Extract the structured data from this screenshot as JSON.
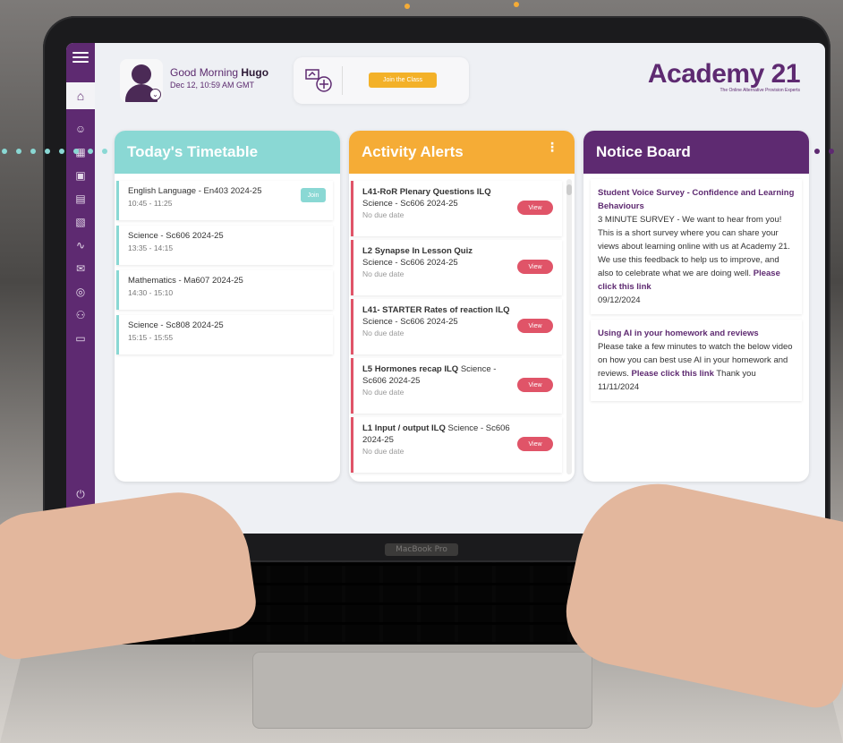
{
  "app": {
    "greeting": "Good Morning",
    "user": "Hugo",
    "datetime": "Dec 12, 10:59 AM GMT",
    "join_button": "Join the Class",
    "brand": "Academy 21",
    "brand_tagline": "The Online Alternative Provision Experts"
  },
  "laptop": {
    "hinge_label": "MacBook Pro"
  },
  "colors": {
    "purple": "#5e2a71",
    "teal": "#8ad8d4",
    "orange": "#f5ac36",
    "red": "#e05468"
  },
  "timetable": {
    "title": "Today's Timetable",
    "items": [
      {
        "subject": "English Language - En403 2024-25",
        "time": "10:45 - 11:25",
        "action": "Join"
      },
      {
        "subject": "Science - Sc606 2024-25",
        "time": "13:35 - 14:15"
      },
      {
        "subject": "Mathematics - Ma607 2024-25",
        "time": "14:30 - 15:10"
      },
      {
        "subject": "Science - Sc808 2024-25",
        "time": "15:15 - 15:55"
      }
    ]
  },
  "alerts": {
    "title": "Activity Alerts",
    "items": [
      {
        "name": "L41-RoR Plenary Questions ILQ",
        "course": "Science - Sc606 2024-25",
        "due": "No due date",
        "action": "View"
      },
      {
        "name": "L2 Synapse In Lesson Quiz",
        "course": "Science - Sc606 2024-25",
        "due": "No due date",
        "action": "View"
      },
      {
        "name": "L41- STARTER Rates of reaction ILQ",
        "course": "Science - Sc606 2024-25",
        "due": "No due date",
        "action": "View"
      },
      {
        "name": "L5 Hormones recap ILQ",
        "course": "Science - Sc606 2024-25",
        "due": "No due date",
        "action": "View"
      },
      {
        "name": "L1 Input / output ILQ",
        "course": "Science - Sc606 2024-25",
        "due": "No due date",
        "action": "View"
      }
    ]
  },
  "notices": {
    "title": "Notice Board",
    "items": [
      {
        "heading": "Student Voice Survey - Confidence and Learning Behaviours",
        "body": "3 MINUTE SURVEY - We want to hear from you! This is a short survey where you can share your views about learning online with us at Academy 21. We use this feedback to help us to improve, and also to celebrate what we are doing well.",
        "link": "Please click this link",
        "after": "",
        "date": "09/12/2024"
      },
      {
        "heading": "Using AI in your homework and reviews",
        "body": "Please take a few minutes to watch the below video on how you can best use AI in your homework and reviews.",
        "link": "Please click this link",
        "after": "Thank you",
        "date": "11/11/2024"
      }
    ]
  }
}
